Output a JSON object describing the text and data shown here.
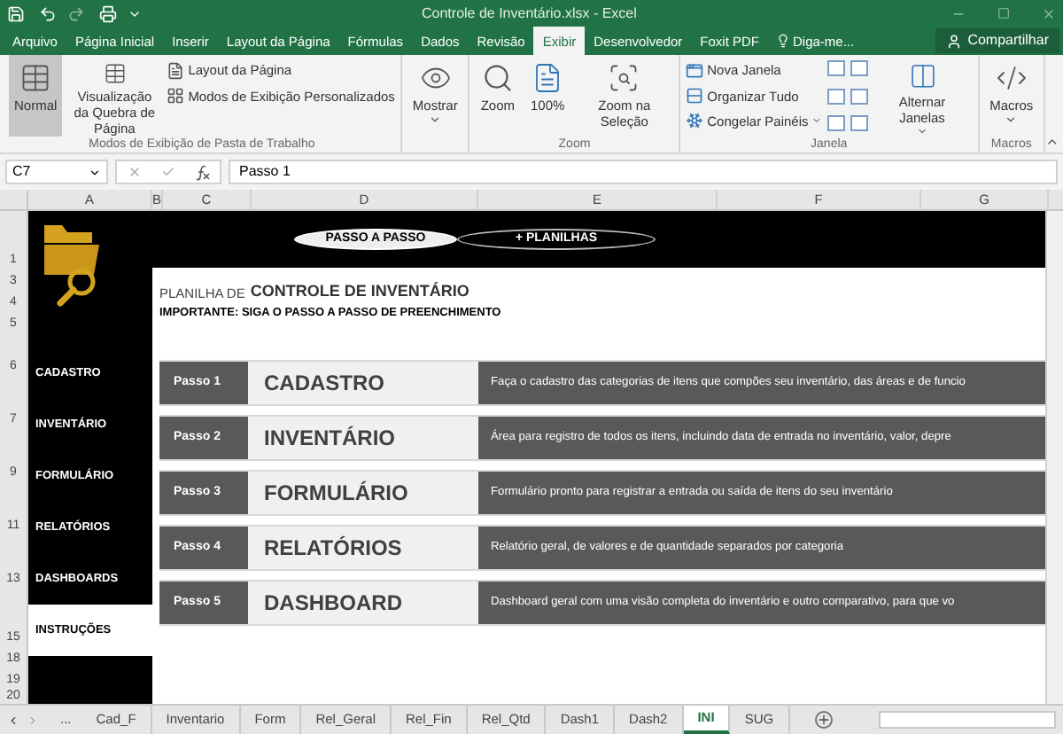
{
  "window": {
    "title": "Controle de Inventário.xlsx - Excel"
  },
  "ribbon_tabs": [
    {
      "label": "Arquivo",
      "selected": false
    },
    {
      "label": "Página Inicial",
      "selected": false
    },
    {
      "label": "Inserir",
      "selected": false
    },
    {
      "label": "Layout da Página",
      "selected": false
    },
    {
      "label": "Fórmulas",
      "selected": false
    },
    {
      "label": "Dados",
      "selected": false
    },
    {
      "label": "Revisão",
      "selected": false
    },
    {
      "label": "Exibir",
      "selected": true
    },
    {
      "label": "Desenvolvedor",
      "selected": false
    },
    {
      "label": "Foxit PDF",
      "selected": false
    }
  ],
  "tell_me": "Diga-me...",
  "share": "Compartilhar",
  "ribbon_groups": [
    {
      "label": "Modos de Exibição de Pasta de Trabalho",
      "buttons": [
        {
          "kind": "large",
          "label": "Normal",
          "selected": true
        },
        {
          "kind": "large",
          "label": "Visualização da Quebra de Página",
          "selected": false
        },
        {
          "kind": "stack",
          "items": [
            {
              "label": "Layout da Página"
            },
            {
              "label": "Modos de Exibição Personalizados"
            }
          ]
        }
      ]
    },
    {
      "buttons": [
        {
          "kind": "large",
          "label": "Mostrar",
          "dropdown": true,
          "selected": false
        }
      ]
    },
    {
      "label": "Zoom",
      "buttons": [
        {
          "kind": "large",
          "label": "Zoom",
          "selected": false
        },
        {
          "kind": "large",
          "label": "100%",
          "selected": false
        },
        {
          "kind": "large",
          "label": "Zoom na Seleção",
          "selected": false
        }
      ]
    },
    {
      "label": "Janela",
      "buttons": [
        {
          "kind": "stack",
          "items": [
            {
              "label": "Nova Janela"
            },
            {
              "label": "Organizar Tudo"
            },
            {
              "label": "Congelar Painéis",
              "dropdown": true
            }
          ]
        },
        {
          "kind": "icons"
        },
        {
          "kind": "large",
          "label": "Alternar Janelas",
          "dropdown": true,
          "selected": false
        }
      ]
    },
    {
      "label": "Macros",
      "buttons": [
        {
          "kind": "large",
          "label": "Macros",
          "dropdown": true,
          "selected": false
        }
      ]
    }
  ],
  "name_box": "C7",
  "formula": "Passo 1",
  "columns": [
    "A",
    "B",
    "C",
    "D",
    "E",
    "F",
    "G"
  ],
  "rows": [
    "1",
    "3",
    "4",
    "5",
    "6",
    "7",
    "9",
    "11",
    "13",
    "15",
    "18",
    "19",
    "20"
  ],
  "sheet": {
    "nav_buttons": [
      {
        "label": "PASSO A PASSO",
        "selected": true
      },
      {
        "label": "+ PLANILHAS",
        "selected": false
      }
    ],
    "heading_prefix": "PLANILHA DE",
    "heading_title": "CONTROLE DE INVENTÁRIO",
    "subtitle": "IMPORTANTE: SIGA O PASSO A PASSO DE PREENCHIMENTO",
    "sidebar": [
      {
        "label": "CADASTRO",
        "selected": false
      },
      {
        "label": "INVENTÁRIO",
        "selected": false
      },
      {
        "label": "FORMULÁRIO",
        "selected": false
      },
      {
        "label": "RELATÓRIOS",
        "selected": false
      },
      {
        "label": "DASHBOARDS",
        "selected": false
      },
      {
        "label": "INSTRUÇÕES",
        "selected": true
      }
    ],
    "steps": [
      {
        "step": "Passo 1",
        "title": "CADASTRO",
        "description": "Faça o cadastro das categorias de itens que compões seu inventário, das áreas e de funcio"
      },
      {
        "step": "Passo 2",
        "title": "INVENTÁRIO",
        "description": "Área para registro de todos os itens, incluindo data de entrada no inventário, valor, depre"
      },
      {
        "step": "Passo 3",
        "title": "FORMULÁRIO",
        "description": "Formulário pronto para registrar a entrada ou saída de itens do seu inventário"
      },
      {
        "step": "Passo 4",
        "title": "RELATÓRIOS",
        "description": "Relatório geral, de valores e de quantidade separados por categoria"
      },
      {
        "step": "Passo 5",
        "title": "DASHBOARD",
        "description": "Dashboard geral com uma visão completa do inventário e outro comparativo, para que vo"
      }
    ]
  },
  "sheet_tabs_more": "...",
  "sheet_tabs": [
    {
      "label": "Cad_F",
      "selected": false
    },
    {
      "label": "Inventario",
      "selected": false
    },
    {
      "label": "Form",
      "selected": false
    },
    {
      "label": "Rel_Geral",
      "selected": false
    },
    {
      "label": "Rel_Fin",
      "selected": false
    },
    {
      "label": "Rel_Qtd",
      "selected": false
    },
    {
      "label": "Dash1",
      "selected": false
    },
    {
      "label": "Dash2",
      "selected": false
    },
    {
      "label": "INI",
      "selected": true
    },
    {
      "label": "SUG",
      "selected": false
    }
  ]
}
